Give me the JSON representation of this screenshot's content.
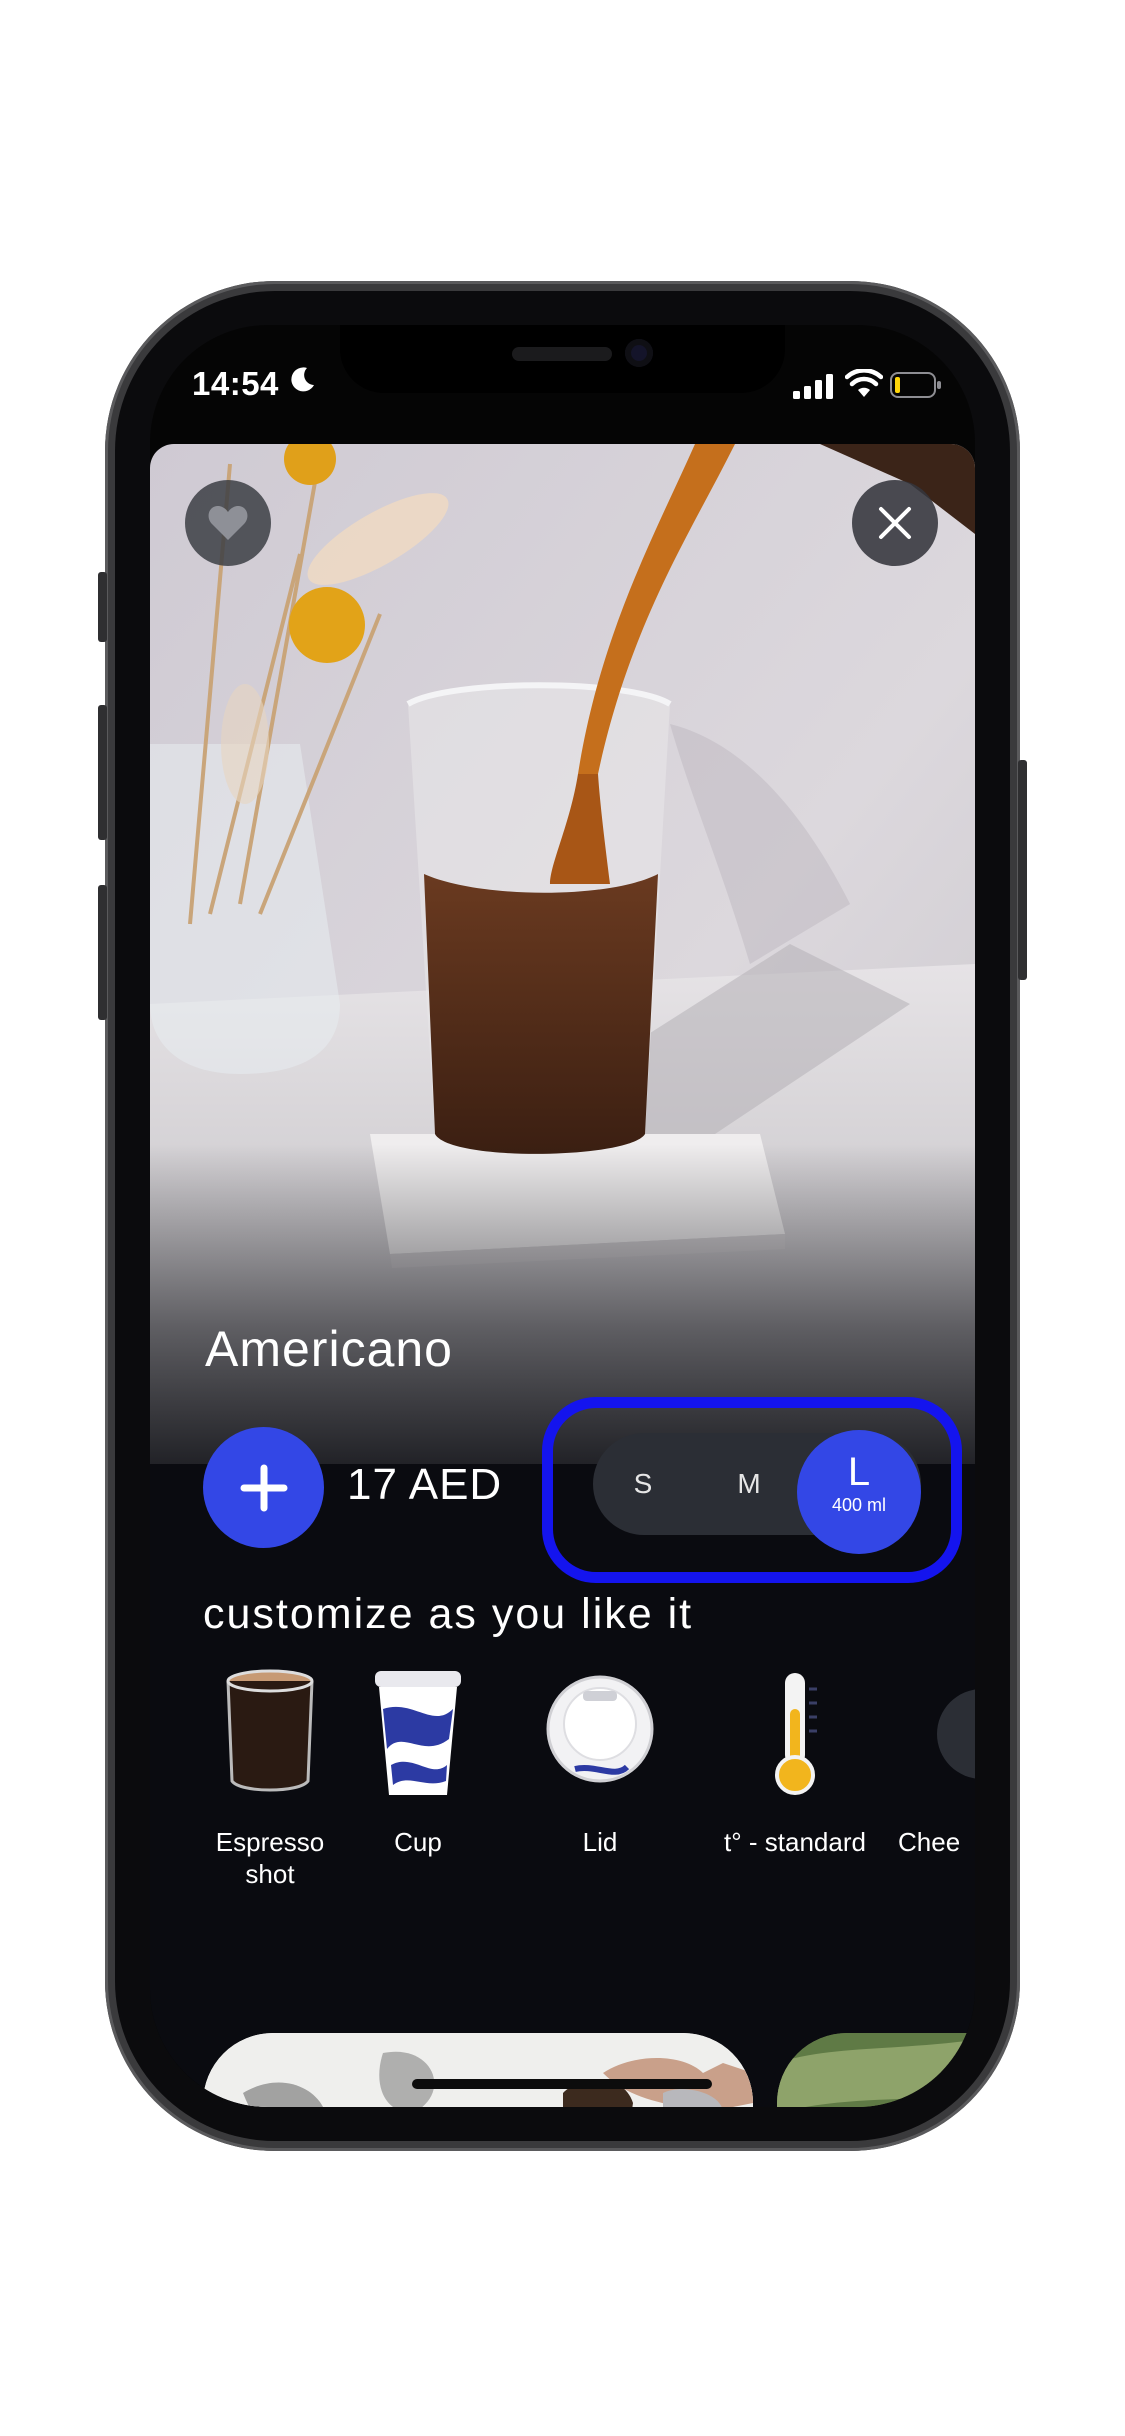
{
  "status_bar": {
    "time": "14:54"
  },
  "product": {
    "name": "Americano",
    "price": "17 AED"
  },
  "sizes": {
    "small": "S",
    "medium": "M",
    "large": "L",
    "large_volume": "400 ml",
    "selected": "L"
  },
  "customize": {
    "heading": "customize as you like it",
    "items": [
      {
        "label": "Espresso\nshot",
        "icon": "espresso-cup-icon"
      },
      {
        "label": "Cup",
        "icon": "paper-cup-icon"
      },
      {
        "label": "Lid",
        "icon": "cup-lid-icon"
      },
      {
        "label": "t° - standard",
        "icon": "thermometer-icon"
      },
      {
        "label": "Chee",
        "icon": "cheese-icon"
      }
    ]
  },
  "colors": {
    "accent": "#3347e6",
    "highlight_outline": "#1414ee",
    "background": "#0a0b10"
  }
}
